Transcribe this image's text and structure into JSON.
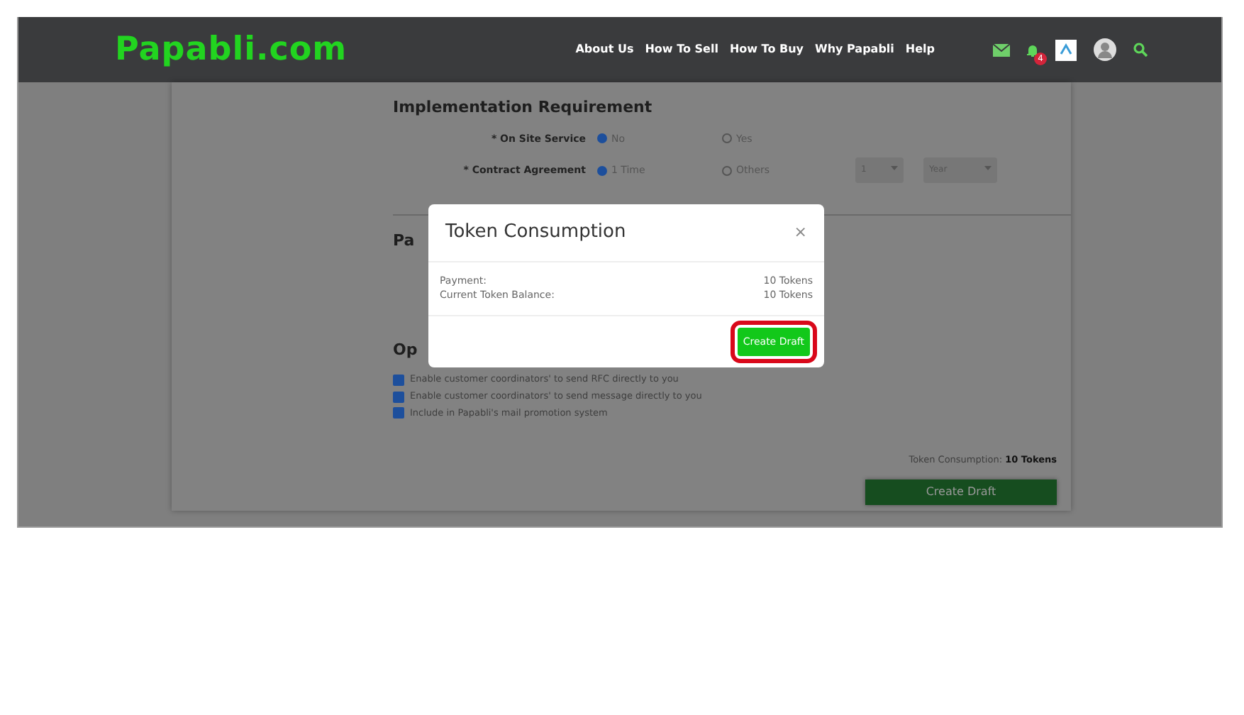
{
  "navbar": {
    "logo": "Papabli",
    "logo_suffix": ".com",
    "links": [
      "About Us",
      "How To Sell",
      "How To Buy",
      "Why Papabli",
      "Help"
    ],
    "notification_count": "4"
  },
  "form": {
    "section_title": "Implementation Requirement",
    "fields": [
      {
        "label": "* On Site Service",
        "options": [
          {
            "label": "No",
            "selected": true
          },
          {
            "label": "Yes",
            "selected": false
          }
        ]
      },
      {
        "label": "* Contract Agreement",
        "options": [
          {
            "label": "1 Time",
            "selected": true
          },
          {
            "label": "Others",
            "selected": false
          }
        ],
        "selects": [
          "1",
          "Year"
        ]
      }
    ],
    "section_2_title": "Pa",
    "section_3_title": "Op",
    "checkboxes": [
      {
        "label": "Enable customer coordinators' to send RFC directly to you",
        "checked": true
      },
      {
        "label": "Enable customer coordinators' to send message directly to you",
        "checked": true
      },
      {
        "label": "Include in Papabli's mail promotion system",
        "checked": true
      }
    ],
    "token_label": "Token Consumption:",
    "token_value": "10 Tokens",
    "submit": "Create Draft"
  },
  "modal": {
    "title": "Token Consumption",
    "close": "×",
    "rows": [
      {
        "label": "Payment:",
        "value": "10 Tokens"
      },
      {
        "label": "Current Token Balance:",
        "value": "10 Tokens"
      }
    ],
    "button": "Create Draft"
  }
}
